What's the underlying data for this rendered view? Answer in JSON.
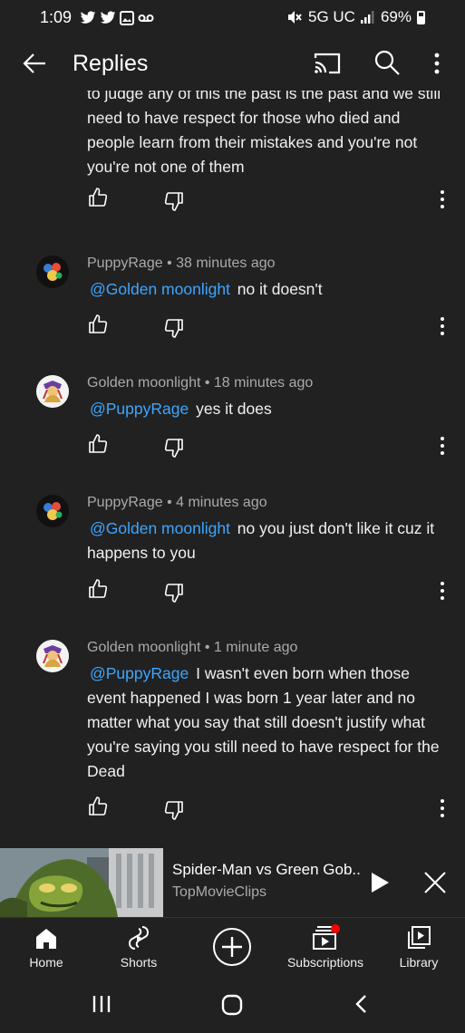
{
  "status_bar": {
    "time": "1:09",
    "network": "5G UC",
    "battery": "69%"
  },
  "header": {
    "title": "Replies"
  },
  "comments": [
    {
      "text": "to judge any of this the past is the past and we still need to have respect for those who died and people learn from their mistakes and you're not you're not one of them"
    },
    {
      "meta": "PuppyRage • 38 minutes ago",
      "mention": "@Golden moonlight",
      "text": " no it doesn't"
    },
    {
      "meta": "Golden moonlight • 18 minutes ago",
      "mention": "@PuppyRage",
      "text": " yes it does"
    },
    {
      "meta": "PuppyRage • 4 minutes ago",
      "mention": "@Golden moonlight",
      "text": " no you just don't like it cuz it happens to you"
    },
    {
      "meta": "Golden moonlight • 1 minute ago",
      "mention": "@PuppyRage",
      "text": " I wasn't even born when those event happened I was born 1 year later and no matter what you say that still doesn't justify what you're saying you still need to have respect for the Dead"
    }
  ],
  "mini_player": {
    "title": "Spider-Man vs Green Gob..",
    "channel": "TopMovieClips"
  },
  "bottom_nav": {
    "items": [
      "Home",
      "Shorts",
      "",
      "Subscriptions",
      "Library"
    ]
  },
  "colors": {
    "background": "#212121",
    "mention": "#3ea6ff",
    "meta": "#aaaaaa",
    "notification_dot": "#ff0000"
  }
}
